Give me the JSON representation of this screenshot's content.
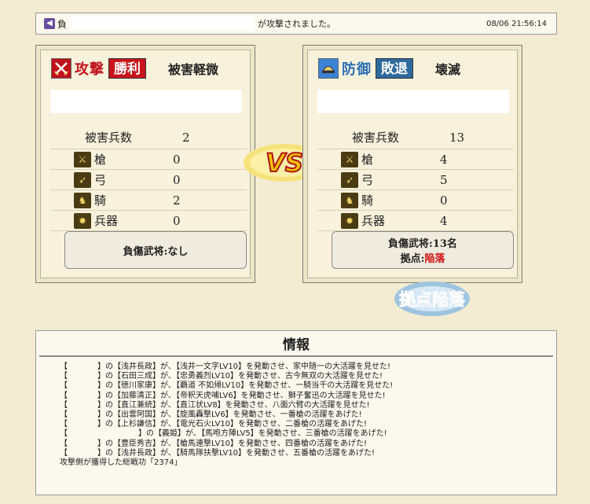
{
  "report": {
    "neg_badge": "◀",
    "neg_label": "負",
    "attack_msg": "が攻撃されました。",
    "timestamp": "08/06 21:56:14"
  },
  "attacker": {
    "role": "攻撃",
    "result": "勝利",
    "damage_level": "被害軽微",
    "total_label": "被害兵数",
    "total": "2",
    "units": [
      {
        "label": "槍",
        "value": "0",
        "icon": "spear-icon"
      },
      {
        "label": "弓",
        "value": "0",
        "icon": "bow-icon"
      },
      {
        "label": "騎",
        "value": "2",
        "icon": "horse-icon"
      },
      {
        "label": "兵器",
        "value": "0",
        "icon": "siege-icon"
      }
    ],
    "wounded": "負傷武将:なし"
  },
  "defender": {
    "role": "防御",
    "result": "敗退",
    "damage_level": "壊滅",
    "total_label": "被害兵数",
    "total": "13",
    "units": [
      {
        "label": "槍",
        "value": "4",
        "icon": "spear-icon"
      },
      {
        "label": "弓",
        "value": "5",
        "icon": "bow-icon"
      },
      {
        "label": "騎",
        "value": "0",
        "icon": "horse-icon"
      },
      {
        "label": "兵器",
        "value": "4",
        "icon": "siege-icon"
      }
    ],
    "wounded": "負傷武将:13名",
    "base_label": "拠点:",
    "base_status": "陥落"
  },
  "vs_label": "VS",
  "captured_banner": "拠点陥落",
  "info": {
    "title": "情報",
    "lines": [
      {
        "pre": "【",
        "blank": "normal",
        "text": "】の【浅井長政】が､【浅井一文字LV10】を発動させ、家中随一の大活躍を見せた!"
      },
      {
        "pre": "【",
        "blank": "normal",
        "text": "】の【石田三成】が､【忠勇義烈LV10】を発動させ、古今無双の大活躍を見せた!"
      },
      {
        "pre": "【",
        "blank": "normal",
        "text": "】の【徳川家康】が､【覇道 不如帰LV10】を発動させ、一騎当千の大活躍を見せた!"
      },
      {
        "pre": "【",
        "blank": "normal",
        "text": "】の【加藤清正】が､【帝釈天虎哺LV6】を発動させ、獅子奮迅の大活躍を見せた!"
      },
      {
        "pre": "【",
        "blank": "normal",
        "text": "】の【直江兼続】が､【直江状LV8】を発動させ、八面六臂の大活躍を見せた!"
      },
      {
        "pre": "【",
        "blank": "normal",
        "text": "】の【出雲阿国】が､【旋風轟撃LV6】を発動させ、一番槍の活躍をあげた!"
      },
      {
        "pre": "【",
        "blank": "normal",
        "text": "】の【上杉謙信】が､【電光石火LV10】を発動させ、二番槍の活躍をあげた!"
      },
      {
        "pre": "【",
        "blank": "wide",
        "text": "】の【義姫】が､【馬咆方陣LV5】を発動させ、三番槍の活躍をあげた!"
      },
      {
        "pre": "【",
        "blank": "normal",
        "text": "】の【豊臣秀吉】が､【槍馬連撃LV10】を発動させ、四番槍の活躍をあげた!"
      },
      {
        "pre": "【",
        "blank": "normal",
        "text": "】の【浅井長政】が､【騎馬隊扶撃LV10】を発動させ、五番槍の活躍をあげた!"
      },
      {
        "pre": "",
        "blank": "none",
        "text": "攻撃側が獲得した総戦功「2374」"
      }
    ]
  },
  "colors": {
    "attack_red": "#c0121c",
    "defense_blue": "#2e6a9e",
    "fallen_red": "#d01010",
    "vs_gold": "#f0c300"
  }
}
